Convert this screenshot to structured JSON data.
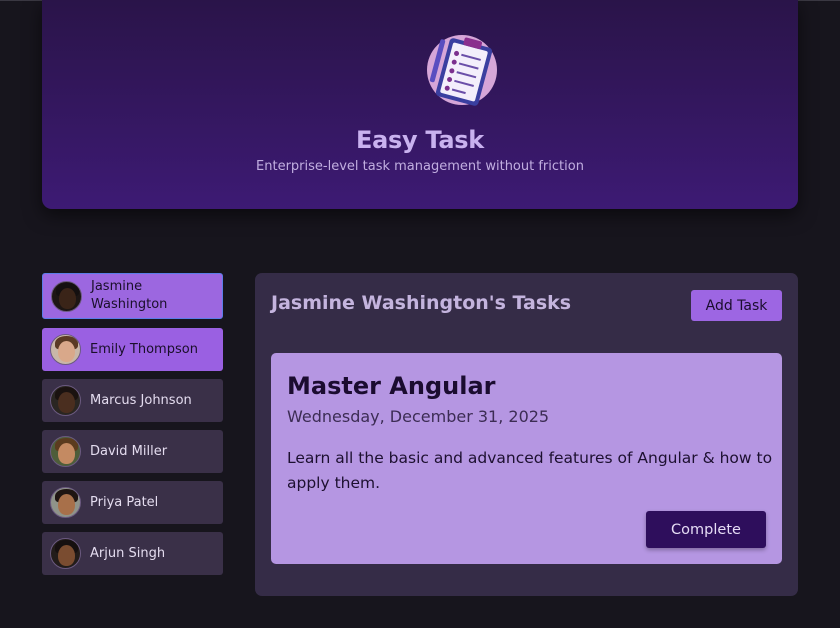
{
  "header": {
    "app_title": "Easy Task",
    "app_subtitle": "Enterprise-level task management without friction",
    "logo_icon": "clipboard-checklist-icon"
  },
  "users": [
    {
      "name": "Jasmine Washington",
      "line1": "Jasmine",
      "line2": "Washington",
      "state": "selected",
      "skin": "#3a2418",
      "hair": "#141010"
    },
    {
      "name": "Emily Thompson",
      "state": "highlighted",
      "skin": "#d9a88a",
      "hair": "#5a3a24"
    },
    {
      "name": "Marcus Johnson",
      "state": "normal",
      "skin": "#4a2e1f",
      "hair": "#1a1210"
    },
    {
      "name": "David Miller",
      "state": "normal",
      "skin": "#c48a62",
      "hair": "#5b3b1e"
    },
    {
      "name": "Priya Patel",
      "state": "normal",
      "skin": "#a8704a",
      "hair": "#1f1512"
    },
    {
      "name": "Arjun Singh",
      "state": "normal",
      "skin": "#7a4c30",
      "hair": "#161010"
    }
  ],
  "tasks_panel": {
    "title": "Jasmine Washington's Tasks",
    "add_button_label": "Add Task"
  },
  "task": {
    "title": "Master Angular",
    "due_date": "Wednesday, December 31, 2025",
    "summary": "Learn all the basic and advanced features of Angular & how to apply them.",
    "complete_button_label": "Complete"
  },
  "colors": {
    "background": "#17151d",
    "accent": "#9d66e3",
    "card": "#b596e2",
    "button_dark": "#2e0e5c"
  }
}
